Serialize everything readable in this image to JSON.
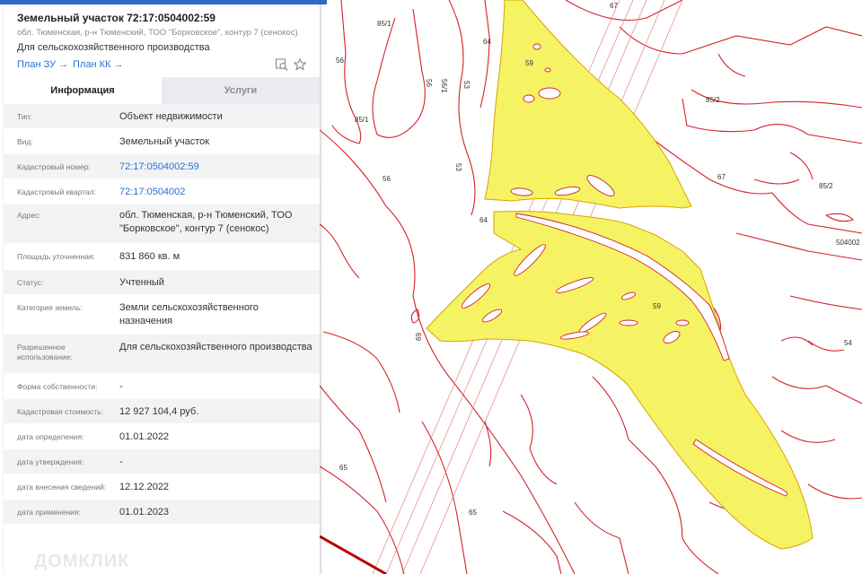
{
  "parcel": {
    "title": "Земельный участок 72:17:0504002:59",
    "subtitle": "обл. Тюменская, р-н Тюменский, ТОО \"Борковское\", контур 7 (сенокос)",
    "purpose": "Для сельскохозяйственного производства",
    "links": {
      "plan_zu": "План ЗУ →",
      "plan_kk": "План КК →"
    }
  },
  "tabs": [
    {
      "label": "Информация",
      "active": true
    },
    {
      "label": "Услуги",
      "active": false
    }
  ],
  "info_rows": [
    {
      "label": "Тип:",
      "value": "Объект недвижимости"
    },
    {
      "label": "Вид:",
      "value": "Земельный участок"
    },
    {
      "label": "Кадастровый номер:",
      "value": "72:17:0504002:59"
    },
    {
      "label": "Кадастровый квартал:",
      "value": "72:17:0504002"
    },
    {
      "label": "Адрес:",
      "value": "обл. Тюменская, р-н Тюменский, ТОО \"Борковское\", контур 7 (сенокос)"
    },
    {
      "label": "Площадь уточненная:",
      "value": "831 860 кв. м"
    },
    {
      "label": "Статус:",
      "value": "Учтенный"
    },
    {
      "label": "Категория земель:",
      "value": "Земли сельскохозяйственного назначения"
    },
    {
      "label": "Разрешенное использование:",
      "value": "Для сельскохозяйственного производства"
    },
    {
      "label": "Форма собственности:",
      "value": "-"
    },
    {
      "label": "Кадастровая стоимость:",
      "value": "12 927 104,4 руб."
    },
    {
      "label": "дата определения:",
      "value": "01.01.2022"
    },
    {
      "label": "дата утверждения:",
      "value": "-"
    },
    {
      "label": "дата внесения сведений:",
      "value": "12.12.2022"
    },
    {
      "label": "дата применения:",
      "value": "01.01.2023"
    }
  ],
  "watermark": "ДОМКЛИК",
  "map": {
    "labels": [
      "59",
      "59",
      "85/1",
      "85/1",
      "56",
      "56",
      "56/1",
      "56",
      "53",
      "53",
      "64",
      "64",
      "65",
      "65",
      "67",
      "67",
      "85/2",
      "85/2",
      "504002",
      "54",
      "69"
    ],
    "colors": {
      "parcel_fill": "#f5f364",
      "parcel_stroke": "#d9a300",
      "boundary": "#d6202a",
      "road": "#b80000"
    }
  },
  "icons": [
    "search-icon",
    "star-icon"
  ]
}
